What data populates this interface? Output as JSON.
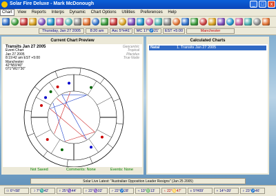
{
  "window": {
    "title": "Solar Fire Deluxe  -  Mark McDonough",
    "minimize": "_",
    "maximize": "□",
    "close": "x"
  },
  "menu": [
    "Chart",
    "View",
    "Reports",
    "Interps",
    "Dynamic",
    "Chart Options",
    "Utilities",
    "Preferences",
    "Help"
  ],
  "toolbar_icons": [
    "open-chart-icon",
    "new-chart-icon",
    "edit-chart-icon",
    "save-icon",
    "print-icon",
    "calendar-icon",
    "chart-wheel-icon",
    "transits-icon",
    "progressions-icon",
    "returns-icon",
    "synastry-icon",
    "composite-icon",
    "harmonics-icon",
    "midpoints-icon",
    "dial-icon",
    "eclipse-icon",
    "globe-icon",
    "planets-icon",
    "aspects-icon",
    "table-icon",
    "info-icon",
    "animate-icon",
    "asteroid-icon",
    "file-icon",
    "timeline-icon",
    "astro-map-icon",
    "ephemeris-icon",
    "favorites-icon",
    "heart-icon",
    "solar-fire-icon"
  ],
  "status": {
    "date": "Thursday, Jan 27 2005",
    "time": "8:20 am",
    "asc": "Asc 5°H41'",
    "mc": "MC 17°♐21'",
    "tz": "EST +5:00",
    "place": "Manchester"
  },
  "preview": {
    "title": "Current Chart Preview",
    "chart_name": "Transits Jan 27 2005",
    "chart_type": "Event Chart",
    "lines": [
      "Jan 27 2005",
      "8:19:42 am  EST +5:00",
      "Manchester",
      "42°N59'40\"",
      "071°W27'30\""
    ],
    "side_lines": [
      "Geocentric",
      "Tropical",
      "Placidus",
      "True Node"
    ],
    "footer_saved": "Not Saved",
    "footer_comments": "Comments: None",
    "footer_events": "Events: None"
  },
  "calculated": {
    "title": "Calculated Charts",
    "rows": [
      {
        "name": "Natal",
        "desc": "1. Transits Jan 27 2005"
      }
    ]
  },
  "news": "Solar Live Latest: \"Australian Opposition Leader Resigns\" (Jan 25 2005)",
  "bottom_positions": [
    "☉ 6°≈58'",
    "☽ 7°♏42'",
    "☿ 25°♑44'",
    "♀ 22°♑02'",
    "♂ 22°♐28'",
    "♃ 13°♎13'",
    "♄ 22°♋47'",
    "♅ 5°H09'",
    "♆ 14°≈39'",
    "♇ 23°♐46'"
  ],
  "colors": {
    "titlebar": "#0a4fc8",
    "selection": "#316ac5",
    "status_text": "#000080",
    "saved_text": "#008000",
    "ring_red": "#cc2222",
    "ring_blue": "#2244cc"
  }
}
